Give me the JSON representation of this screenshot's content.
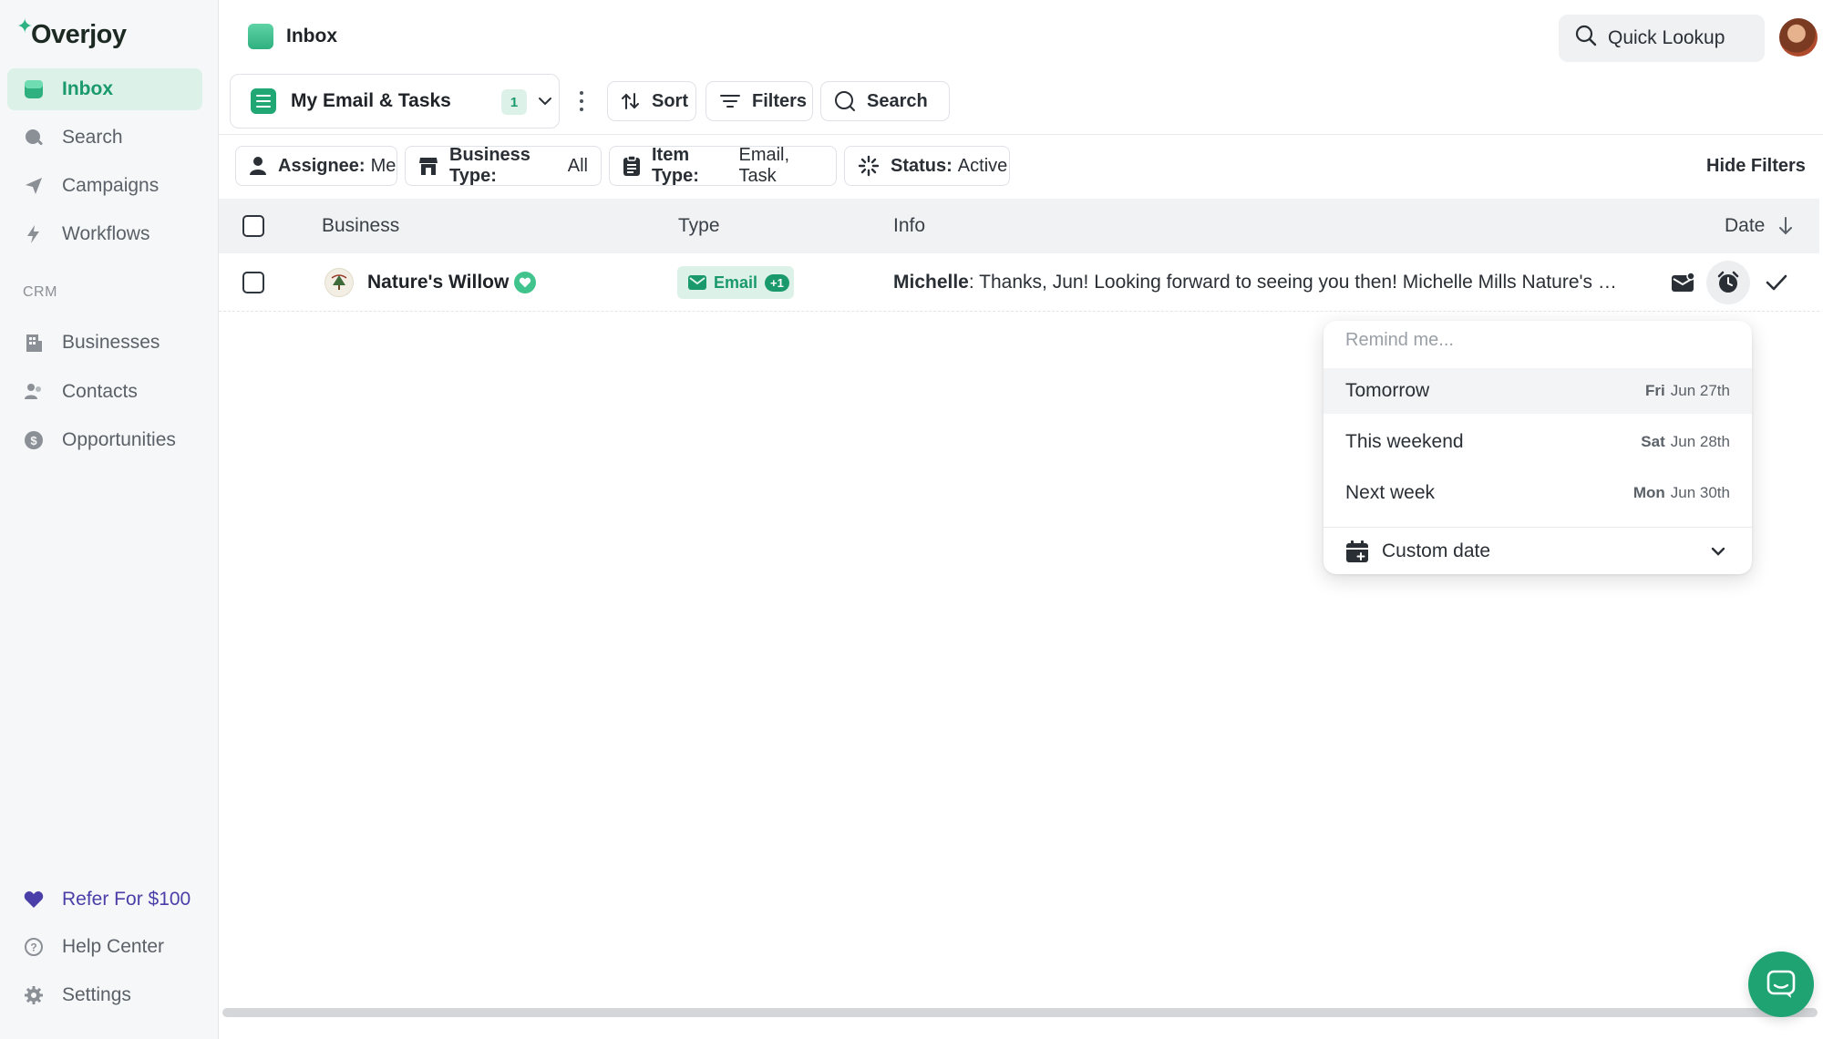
{
  "app": {
    "name": "Overjoy"
  },
  "sidebar": {
    "items": [
      {
        "label": "Inbox",
        "icon": "inbox-icon"
      },
      {
        "label": "Search",
        "icon": "search-icon"
      },
      {
        "label": "Campaigns",
        "icon": "send-icon"
      },
      {
        "label": "Workflows",
        "icon": "bolt-icon"
      }
    ],
    "crm_label": "CRM",
    "crm_items": [
      {
        "label": "Businesses",
        "icon": "building-icon"
      },
      {
        "label": "Contacts",
        "icon": "contacts-icon"
      },
      {
        "label": "Opportunities",
        "icon": "dollar-icon"
      }
    ],
    "bottom": {
      "refer": "Refer For $100",
      "help": "Help Center",
      "settings": "Settings"
    }
  },
  "header": {
    "title": "Inbox",
    "quick_lookup": "Quick Lookup"
  },
  "toolbar": {
    "view_name": "My Email & Tasks",
    "view_count": "1",
    "sort": "Sort",
    "filters": "Filters",
    "search": "Search"
  },
  "filters": {
    "assignee": {
      "label": "Assignee:",
      "value": "Me"
    },
    "business_type": {
      "label": "Business Type:",
      "value": "All"
    },
    "item_type": {
      "label": "Item Type:",
      "value": "Email, Task"
    },
    "status": {
      "label": "Status:",
      "value": "Active"
    },
    "hide": "Hide Filters"
  },
  "table": {
    "columns": {
      "business": "Business",
      "type": "Type",
      "info": "Info",
      "date": "Date"
    },
    "rows": [
      {
        "business": "Nature's Willow",
        "type": "Email",
        "type_extra": "+1",
        "sender": "Michelle",
        "message": ": Thanks, Jun! Looking forward to seeing you then! Michelle Mills Nature's Willow"
      }
    ]
  },
  "remind_menu": {
    "header": "Remind me...",
    "options": [
      {
        "label": "Tomorrow",
        "day": "Fri",
        "date": "Jun 27th"
      },
      {
        "label": "This weekend",
        "day": "Sat",
        "date": "Jun 28th"
      },
      {
        "label": "Next week",
        "day": "Mon",
        "date": "Jun 30th"
      }
    ],
    "custom": "Custom date"
  },
  "colors": {
    "accent": "#1a9a6c",
    "accent_light": "#dcf2e8",
    "refer": "#4a3fa8"
  }
}
